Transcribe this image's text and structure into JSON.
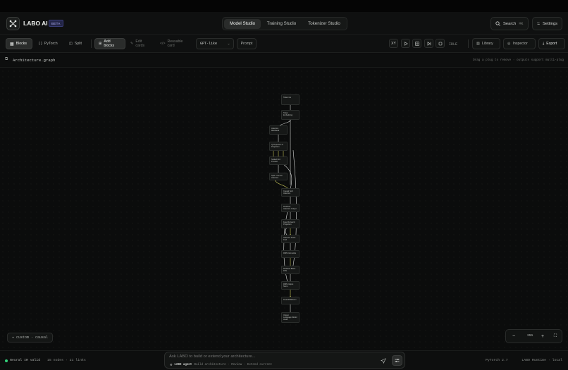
{
  "app": {
    "name": "LABO AI",
    "badge": "BETA"
  },
  "studios": [
    {
      "label": "Model Studio",
      "active": true
    },
    {
      "label": "Training Studio",
      "active": false
    },
    {
      "label": "Tokenizer Studio",
      "active": false
    }
  ],
  "header": {
    "search_label": "Search",
    "search_shortcut": "⌘K",
    "settings_label": "Settings"
  },
  "toolbar": {
    "views": [
      {
        "label": "Blocks",
        "icon": "blocks-icon",
        "active": true
      },
      {
        "label": "PyTorch",
        "icon": "code-braces-icon",
        "active": false
      },
      {
        "label": "Split",
        "icon": "split-icon",
        "active": false
      }
    ],
    "add_blocks": "Add blocks",
    "edit_cards": "Edit cards",
    "reusable_card": "Reusable card",
    "preset_value": "GPT-like",
    "prompt_label": "Prompt",
    "run_controls": [
      "XY",
      "play-icon",
      "grid-icon",
      "step-icon",
      "stop-icon"
    ],
    "xy_label": "XY",
    "status": "IDLE",
    "library_label": "Library",
    "inspector_label": "Inspector",
    "export_label": "Export"
  },
  "subbar": {
    "file_title": "Architecture.graph",
    "hint": "Drag a plug to remove · outputs support multi-plug"
  },
  "graph": {
    "nodes": [
      "Token ids",
      "Token Embedding",
      "Attention Multihead",
      "Q Projection K Projection",
      "Scaled Dot Product",
      "Split / Concat Attention",
      "Causal Self-Attention",
      "Residual Attention Output",
      "Feed-Forward Projection",
      "Attention Feed-Fwd",
      "RMS Normalize",
      "Residual Block FFN",
      "RMS Output Norm",
      "Final RMSNorm",
      "Output Language Model Head"
    ],
    "node_count": 15,
    "link_count": 21
  },
  "canvas": {
    "preset_chip": "custom · causal",
    "zoom_label": "35%"
  },
  "status": {
    "validity": "Neural IR valid",
    "counts": "15 nodes · 21 links",
    "framework": "PyTorch 2.7",
    "runtime": "LABO Runtime · local"
  },
  "agent": {
    "placeholder": "Ask LABO to build or extend your architecture...",
    "name": "LABO agent",
    "hint": "Build architecture · Review · Extend current"
  },
  "colors": {
    "accent_green": "#33d17a",
    "link_yellow": "#c9c85a",
    "link_white": "#d8dad8",
    "beta_badge": "#232546"
  }
}
